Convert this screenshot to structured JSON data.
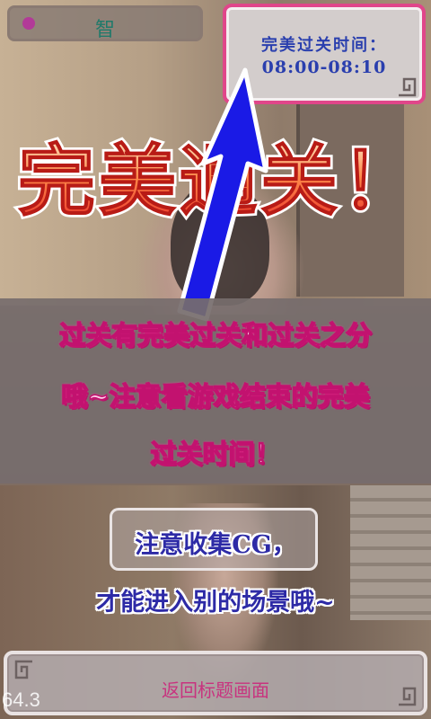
{
  "top_bar": {
    "label": "智"
  },
  "time_panel": {
    "title": "完美过关时间：",
    "time_range": "08:00-08:10"
  },
  "banner": {
    "text": "完美通关！"
  },
  "tutorial": {
    "lines": [
      "过关有完美过关和过关之分",
      "哦~注意看游戏结束的完美",
      "过关时间！"
    ]
  },
  "cg_tip": {
    "lines": [
      "注意收集CG，",
      "才能进入别的场景哦~"
    ]
  },
  "return_button": {
    "label": "返回标题画面"
  },
  "fps": "64.3",
  "colors": {
    "accent_pink": "#e0468a",
    "panel_text_blue": "#2a3fae",
    "arrow_blue": "#1a1ae6",
    "banner_red": "#e8302a"
  },
  "icons": [
    "circle-dot-icon",
    "corner-ornament-icon",
    "up-arrow-icon"
  ]
}
